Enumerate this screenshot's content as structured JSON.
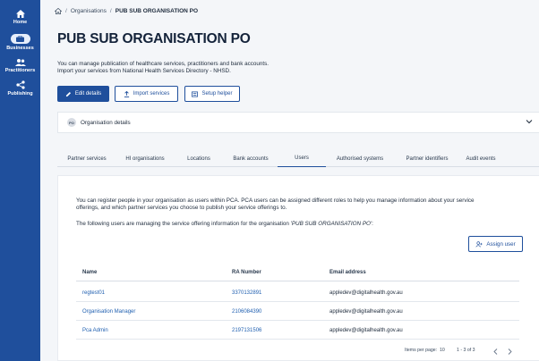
{
  "sidebar": {
    "items": [
      {
        "label": "Home",
        "icon": "home-icon"
      },
      {
        "label": "Businesses",
        "icon": "businesses-icon"
      },
      {
        "label": "Practitioners",
        "icon": "practitioners-icon"
      },
      {
        "label": "Publishing",
        "icon": "share-icon"
      }
    ]
  },
  "breadcrumb": {
    "items": [
      "Organisations",
      "PUB SUB ORGANISATION PO"
    ]
  },
  "page": {
    "title": "PUB SUB ORGANISATION PO",
    "intro_line1": "You can manage publication of healthcare services, practitioners and bank accounts.",
    "intro_line2": "Import your services from National Health Services Directory - NHSD."
  },
  "actions": {
    "edit": "Edit details",
    "import": "Import services",
    "setup": "Setup helper"
  },
  "org_panel": {
    "badge": "PO",
    "label": "Organisation details"
  },
  "tabs": [
    {
      "label": "Partner services",
      "active": false
    },
    {
      "label": "HI organisations",
      "active": false
    },
    {
      "label": "Locations",
      "active": false
    },
    {
      "label": "Bank accounts",
      "active": false
    },
    {
      "label": "Users",
      "active": true
    },
    {
      "label": "Authorised systems",
      "active": false
    },
    {
      "label": "Partner identifiers",
      "active": false
    },
    {
      "label": "Audit events",
      "active": false
    }
  ],
  "users": {
    "description_l1": "You can register people in your organisation as users within PCA. PCA users can be assigned different roles to help you manage information about your service",
    "description_l2": "offerings, and which partner services you choose to publish your service offerings to.",
    "managing_prefix": "The following users are managing the service offering information for the organisation ",
    "managing_org": "'PUB SUB ORGANISATION PO'",
    "managing_suffix": ":",
    "assign_label": "Assign user",
    "columns": [
      "Name",
      "RA Number",
      "Email address"
    ],
    "rows": [
      {
        "name": "regtest01",
        "ra": "3370132891",
        "email": "appledev@digitalhealth.gov.au"
      },
      {
        "name": "Organisation Manager",
        "ra": "2106084390",
        "email": "appledev@digitalhealth.gov.au"
      },
      {
        "name": "Pca Admin",
        "ra": "2197131506",
        "email": "appledev@digitalhealth.gov.au"
      }
    ],
    "pager": {
      "items_per_page_label": "Items per page:",
      "items_per_page": "10",
      "range": "1 - 3 of 3"
    }
  },
  "colors": {
    "primary": "#1f4f9c",
    "link": "#1f5fb0",
    "background": "#f4f6f9"
  }
}
